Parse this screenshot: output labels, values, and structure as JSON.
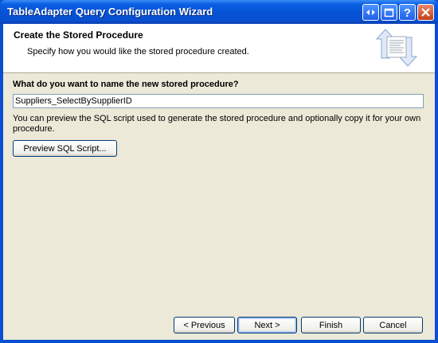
{
  "window": {
    "title": "TableAdapter Query Configuration Wizard",
    "controls": [
      "context-help-icon",
      "restore-icon",
      "help-icon",
      "close-icon"
    ],
    "colors": {
      "titlebar": "#0553d6",
      "client": "#ece9d8"
    }
  },
  "header": {
    "title": "Create the Stored Procedure",
    "subtitle": "Specify how you would like the stored procedure created."
  },
  "form": {
    "question": "What do you want to name the new stored procedure?",
    "name_value": "Suppliers_SelectBySupplierID",
    "description": "You can preview the SQL script used to generate the stored procedure and optionally copy it for your own procedure.",
    "preview_label": "Preview SQL Script..."
  },
  "footer": {
    "previous_label": "< Previous",
    "next_label": "Next >",
    "finish_label": "Finish",
    "cancel_label": "Cancel"
  }
}
